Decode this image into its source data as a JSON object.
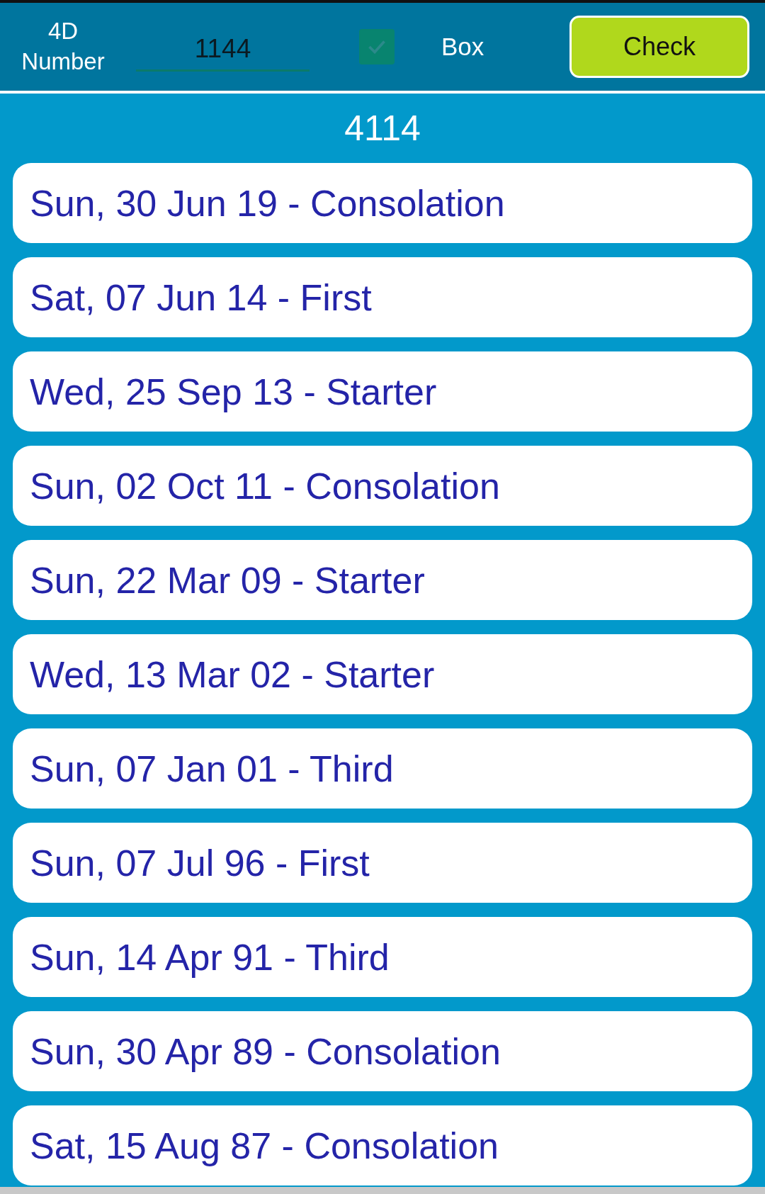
{
  "header": {
    "label": "4D Number",
    "number_field": {
      "value": "1144"
    },
    "box_checkbox": {
      "label": "Box",
      "checked": true
    },
    "check_button": {
      "label": "Check"
    }
  },
  "permutation": "4114",
  "results": [
    {
      "text": "Sun, 30 Jun 19 - Consolation"
    },
    {
      "text": "Sat, 07 Jun 14 - First"
    },
    {
      "text": "Wed, 25 Sep 13 - Starter"
    },
    {
      "text": "Sun, 02 Oct 11 - Consolation"
    },
    {
      "text": "Sun, 22 Mar 09 - Starter"
    },
    {
      "text": "Wed, 13 Mar 02 - Starter"
    },
    {
      "text": "Sun, 07 Jan 01 - Third"
    },
    {
      "text": "Sun, 07 Jul 96 - First"
    },
    {
      "text": "Sun, 14 Apr 91 - Third"
    },
    {
      "text": "Sun, 30 Apr 89 - Consolation"
    },
    {
      "text": "Sat, 15 Aug 87 - Consolation"
    }
  ]
}
